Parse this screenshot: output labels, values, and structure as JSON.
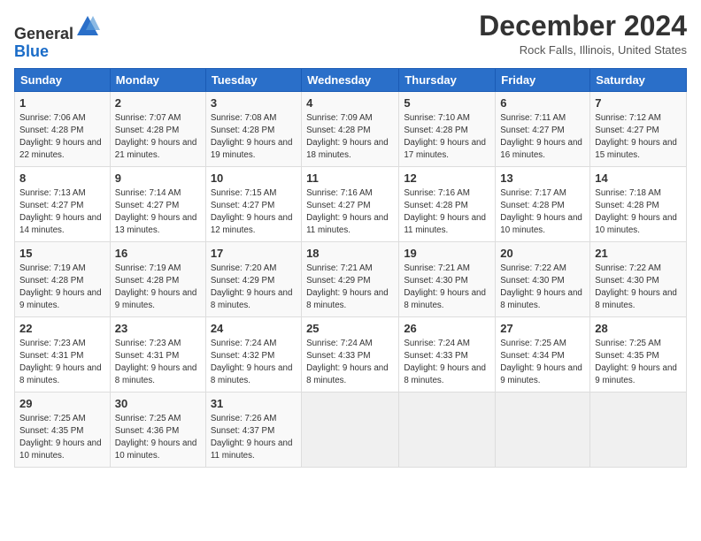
{
  "header": {
    "logo": {
      "line1": "General",
      "line2": "Blue"
    },
    "title": "December 2024",
    "location": "Rock Falls, Illinois, United States"
  },
  "weekdays": [
    "Sunday",
    "Monday",
    "Tuesday",
    "Wednesday",
    "Thursday",
    "Friday",
    "Saturday"
  ],
  "weeks": [
    [
      {
        "day": "1",
        "sunrise": "Sunrise: 7:06 AM",
        "sunset": "Sunset: 4:28 PM",
        "daylight": "Daylight: 9 hours and 22 minutes."
      },
      {
        "day": "2",
        "sunrise": "Sunrise: 7:07 AM",
        "sunset": "Sunset: 4:28 PM",
        "daylight": "Daylight: 9 hours and 21 minutes."
      },
      {
        "day": "3",
        "sunrise": "Sunrise: 7:08 AM",
        "sunset": "Sunset: 4:28 PM",
        "daylight": "Daylight: 9 hours and 19 minutes."
      },
      {
        "day": "4",
        "sunrise": "Sunrise: 7:09 AM",
        "sunset": "Sunset: 4:28 PM",
        "daylight": "Daylight: 9 hours and 18 minutes."
      },
      {
        "day": "5",
        "sunrise": "Sunrise: 7:10 AM",
        "sunset": "Sunset: 4:28 PM",
        "daylight": "Daylight: 9 hours and 17 minutes."
      },
      {
        "day": "6",
        "sunrise": "Sunrise: 7:11 AM",
        "sunset": "Sunset: 4:27 PM",
        "daylight": "Daylight: 9 hours and 16 minutes."
      },
      {
        "day": "7",
        "sunrise": "Sunrise: 7:12 AM",
        "sunset": "Sunset: 4:27 PM",
        "daylight": "Daylight: 9 hours and 15 minutes."
      }
    ],
    [
      {
        "day": "8",
        "sunrise": "Sunrise: 7:13 AM",
        "sunset": "Sunset: 4:27 PM",
        "daylight": "Daylight: 9 hours and 14 minutes."
      },
      {
        "day": "9",
        "sunrise": "Sunrise: 7:14 AM",
        "sunset": "Sunset: 4:27 PM",
        "daylight": "Daylight: 9 hours and 13 minutes."
      },
      {
        "day": "10",
        "sunrise": "Sunrise: 7:15 AM",
        "sunset": "Sunset: 4:27 PM",
        "daylight": "Daylight: 9 hours and 12 minutes."
      },
      {
        "day": "11",
        "sunrise": "Sunrise: 7:16 AM",
        "sunset": "Sunset: 4:27 PM",
        "daylight": "Daylight: 9 hours and 11 minutes."
      },
      {
        "day": "12",
        "sunrise": "Sunrise: 7:16 AM",
        "sunset": "Sunset: 4:28 PM",
        "daylight": "Daylight: 9 hours and 11 minutes."
      },
      {
        "day": "13",
        "sunrise": "Sunrise: 7:17 AM",
        "sunset": "Sunset: 4:28 PM",
        "daylight": "Daylight: 9 hours and 10 minutes."
      },
      {
        "day": "14",
        "sunrise": "Sunrise: 7:18 AM",
        "sunset": "Sunset: 4:28 PM",
        "daylight": "Daylight: 9 hours and 10 minutes."
      }
    ],
    [
      {
        "day": "15",
        "sunrise": "Sunrise: 7:19 AM",
        "sunset": "Sunset: 4:28 PM",
        "daylight": "Daylight: 9 hours and 9 minutes."
      },
      {
        "day": "16",
        "sunrise": "Sunrise: 7:19 AM",
        "sunset": "Sunset: 4:28 PM",
        "daylight": "Daylight: 9 hours and 9 minutes."
      },
      {
        "day": "17",
        "sunrise": "Sunrise: 7:20 AM",
        "sunset": "Sunset: 4:29 PM",
        "daylight": "Daylight: 9 hours and 8 minutes."
      },
      {
        "day": "18",
        "sunrise": "Sunrise: 7:21 AM",
        "sunset": "Sunset: 4:29 PM",
        "daylight": "Daylight: 9 hours and 8 minutes."
      },
      {
        "day": "19",
        "sunrise": "Sunrise: 7:21 AM",
        "sunset": "Sunset: 4:30 PM",
        "daylight": "Daylight: 9 hours and 8 minutes."
      },
      {
        "day": "20",
        "sunrise": "Sunrise: 7:22 AM",
        "sunset": "Sunset: 4:30 PM",
        "daylight": "Daylight: 9 hours and 8 minutes."
      },
      {
        "day": "21",
        "sunrise": "Sunrise: 7:22 AM",
        "sunset": "Sunset: 4:30 PM",
        "daylight": "Daylight: 9 hours and 8 minutes."
      }
    ],
    [
      {
        "day": "22",
        "sunrise": "Sunrise: 7:23 AM",
        "sunset": "Sunset: 4:31 PM",
        "daylight": "Daylight: 9 hours and 8 minutes."
      },
      {
        "day": "23",
        "sunrise": "Sunrise: 7:23 AM",
        "sunset": "Sunset: 4:31 PM",
        "daylight": "Daylight: 9 hours and 8 minutes."
      },
      {
        "day": "24",
        "sunrise": "Sunrise: 7:24 AM",
        "sunset": "Sunset: 4:32 PM",
        "daylight": "Daylight: 9 hours and 8 minutes."
      },
      {
        "day": "25",
        "sunrise": "Sunrise: 7:24 AM",
        "sunset": "Sunset: 4:33 PM",
        "daylight": "Daylight: 9 hours and 8 minutes."
      },
      {
        "day": "26",
        "sunrise": "Sunrise: 7:24 AM",
        "sunset": "Sunset: 4:33 PM",
        "daylight": "Daylight: 9 hours and 8 minutes."
      },
      {
        "day": "27",
        "sunrise": "Sunrise: 7:25 AM",
        "sunset": "Sunset: 4:34 PM",
        "daylight": "Daylight: 9 hours and 9 minutes."
      },
      {
        "day": "28",
        "sunrise": "Sunrise: 7:25 AM",
        "sunset": "Sunset: 4:35 PM",
        "daylight": "Daylight: 9 hours and 9 minutes."
      }
    ],
    [
      {
        "day": "29",
        "sunrise": "Sunrise: 7:25 AM",
        "sunset": "Sunset: 4:35 PM",
        "daylight": "Daylight: 9 hours and 10 minutes."
      },
      {
        "day": "30",
        "sunrise": "Sunrise: 7:25 AM",
        "sunset": "Sunset: 4:36 PM",
        "daylight": "Daylight: 9 hours and 10 minutes."
      },
      {
        "day": "31",
        "sunrise": "Sunrise: 7:26 AM",
        "sunset": "Sunset: 4:37 PM",
        "daylight": "Daylight: 9 hours and 11 minutes."
      },
      null,
      null,
      null,
      null
    ]
  ]
}
